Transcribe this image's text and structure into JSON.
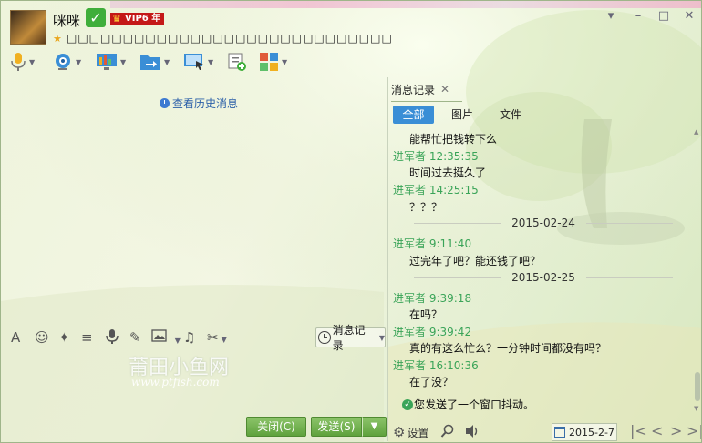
{
  "contact": {
    "name": "咪咪",
    "vip_label": "VIP6 年",
    "signature": "□□□□□□□□□□□□□□□□□□□□□□□□□□□□□"
  },
  "window_controls": [
    "▾",
    "–",
    "□",
    "✕"
  ],
  "toolbar_icons": [
    "microphone-icon",
    "video-camera-icon",
    "screen-share-icon",
    "file-transfer-icon",
    "remote-assist-icon",
    "create-group-icon",
    "apps-icon"
  ],
  "left": {
    "history_link": "查看历史消息",
    "input_tools": [
      "A",
      "☺",
      "✂",
      "≡",
      "🎤",
      "✎",
      "▣",
      "♫",
      "✂"
    ],
    "msg_record_btn": "消息记录",
    "watermark": "莆田小鱼网",
    "watermark_url": "www.ptfish.com",
    "close_btn": "关闭(C)",
    "send_btn": "发送(S)"
  },
  "right": {
    "tab_label": "消息记录",
    "filters": [
      "全部",
      "图片",
      "文件"
    ],
    "messages": [
      {
        "type": "body",
        "text": "能帮忙把钱转下么"
      },
      {
        "type": "sender",
        "text": "进军者 12:35:35"
      },
      {
        "type": "body",
        "text": "时间过去挺久了"
      },
      {
        "type": "sender",
        "text": "进军者 14:25:15"
      },
      {
        "type": "body",
        "text": "？？？"
      },
      {
        "type": "date",
        "text": "2015-02-24"
      },
      {
        "type": "sender",
        "text": "进军者 9:11:40"
      },
      {
        "type": "body",
        "text": "过完年了吧？能还钱了吧？"
      },
      {
        "type": "date",
        "text": "2015-02-25"
      },
      {
        "type": "sender",
        "text": "进军者 9:39:18"
      },
      {
        "type": "body",
        "text": "在吗？"
      },
      {
        "type": "sender",
        "text": "进军者 9:39:42"
      },
      {
        "type": "body",
        "text": "真的有这么忙么？一分钟时间都没有吗？"
      },
      {
        "type": "sender",
        "text": "进军者 16:10:36"
      },
      {
        "type": "body",
        "text": "在了没？"
      },
      {
        "type": "shake",
        "text": "您发送了一个窗口抖动。"
      }
    ],
    "settings_label": "设置",
    "date_value": "2015-2-7",
    "nav": [
      "|<",
      "<",
      ">",
      ">|"
    ]
  },
  "colors": {
    "accent_blue": "#3a8ed6",
    "sender_green": "#3aa458",
    "button_green": "#5fa23d"
  }
}
